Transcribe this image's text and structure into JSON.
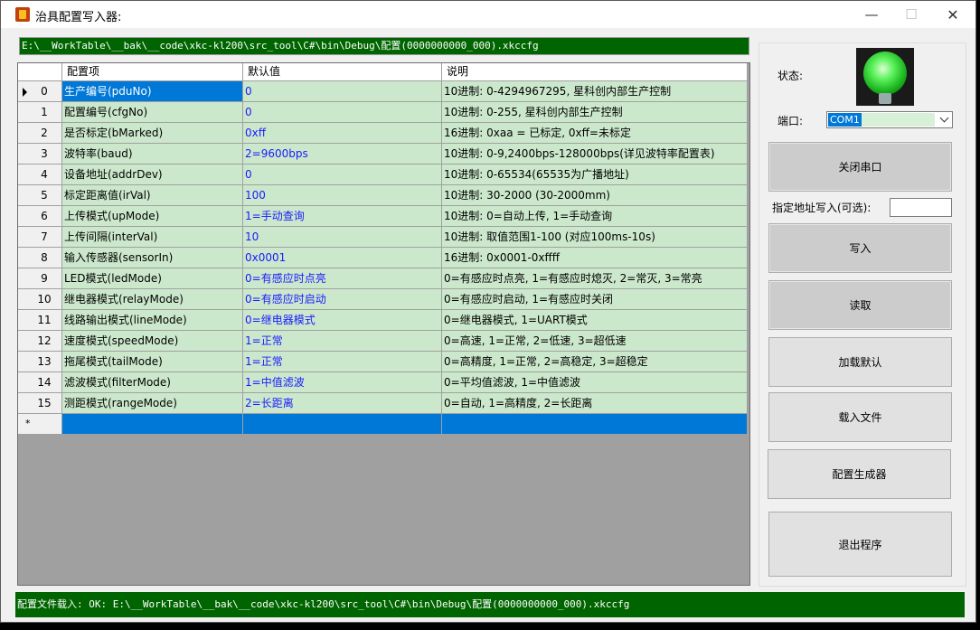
{
  "window": {
    "title": "治具配置写入器:"
  },
  "path_bar": "E:\\__WorkTable\\__bak\\__code\\xkc-kl200\\src_tool\\C#\\bin\\Debug\\配置(0000000000_000).xkccfg",
  "grid": {
    "headers": [
      "",
      "配置项",
      "默认值",
      "说明"
    ],
    "rows": [
      {
        "idx": "0",
        "item": "生产编号(pduNo)",
        "default": "0",
        "desc": "10进制: 0-4294967295, 星科创内部生产控制"
      },
      {
        "idx": "1",
        "item": "配置编号(cfgNo)",
        "default": "0",
        "desc": "10进制: 0-255, 星科创内部生产控制"
      },
      {
        "idx": "2",
        "item": "是否标定(bMarked)",
        "default": "0xff",
        "desc": "16进制: 0xaa = 已标定, 0xff=未标定"
      },
      {
        "idx": "3",
        "item": "波特率(baud)",
        "default": "2=9600bps",
        "desc": "10进制: 0-9,2400bps-128000bps(详见波特率配置表)"
      },
      {
        "idx": "4",
        "item": "设备地址(addrDev)",
        "default": "0",
        "desc": "10进制: 0-65534(65535为广播地址)"
      },
      {
        "idx": "5",
        "item": "标定距离值(irVal)",
        "default": "100",
        "desc": "10进制: 30-2000 (30-2000mm)"
      },
      {
        "idx": "6",
        "item": "上传模式(upMode)",
        "default": "1=手动查询",
        "desc": "10进制: 0=自动上传, 1=手动查询"
      },
      {
        "idx": "7",
        "item": "上传间隔(interVal)",
        "default": "10",
        "desc": "10进制: 取值范围1-100 (对应100ms-10s)"
      },
      {
        "idx": "8",
        "item": "输入传感器(sensorIn)",
        "default": "0x0001",
        "desc": "16进制: 0x0001-0xffff"
      },
      {
        "idx": "9",
        "item": "LED模式(ledMode)",
        "default": "0=有感应时点亮",
        "desc": "0=有感应时点亮, 1=有感应时熄灭, 2=常灭, 3=常亮"
      },
      {
        "idx": "10",
        "item": "继电器模式(relayMode)",
        "default": "0=有感应时启动",
        "desc": "0=有感应时启动, 1=有感应时关闭"
      },
      {
        "idx": "11",
        "item": "线路输出模式(lineMode)",
        "default": "0=继电器模式",
        "desc": "0=继电器模式, 1=UART模式"
      },
      {
        "idx": "12",
        "item": "速度模式(speedMode)",
        "default": "1=正常",
        "desc": "0=高速, 1=正常, 2=低速, 3=超低速"
      },
      {
        "idx": "13",
        "item": "拖尾模式(tailMode)",
        "default": "1=正常",
        "desc": "0=高精度, 1=正常, 2=高稳定, 3=超稳定"
      },
      {
        "idx": "14",
        "item": "滤波模式(filterMode)",
        "default": "1=中值滤波",
        "desc": "0=平均值滤波, 1=中值滤波"
      },
      {
        "idx": "15",
        "item": "测距模式(rangeMode)",
        "default": "2=长距离",
        "desc": "0=自动, 1=高精度, 2=长距离"
      }
    ],
    "new_row_marker": "*"
  },
  "side": {
    "status_label": "状态:",
    "port_label": "端口:",
    "port_value": "COM1",
    "addr_label": "指定地址写入(可选):",
    "addr_value": "",
    "buttons": {
      "close_port": "关闭串口",
      "write": "写入",
      "read": "读取",
      "load_default": "加载默认",
      "load_file": "载入文件",
      "config_gen": "配置生成器",
      "exit": "退出程序"
    }
  },
  "status_bar": "配置文件载入: OK: E:\\__WorkTable\\__bak\\__code\\xkc-kl200\\src_tool\\C#\\bin\\Debug\\配置(0000000000_000).xkccfg",
  "colors": {
    "status_green": "#006400",
    "row_green": "#cce8cc",
    "selection_blue": "#0078d7",
    "value_blue": "#1a1aff"
  }
}
